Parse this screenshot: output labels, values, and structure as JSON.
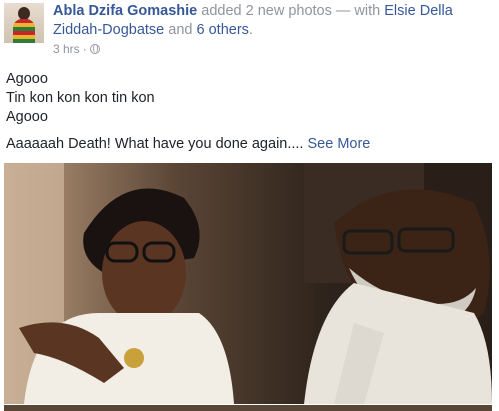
{
  "post": {
    "author": "Abla Dzifa Gomashie",
    "action": "added 2 new photos",
    "with_separator": "— with",
    "tagged": "Elsie Della Ziddah-Dogbatse",
    "and": "and",
    "others": "6 others",
    "period": ".",
    "timestamp": "3 hrs",
    "dot": "·",
    "privacy_icon": "globe-icon",
    "lines": [
      "Agooo",
      "Tin kon kon kon tin kon",
      "Agooo"
    ],
    "last_line": "Aaaaaah Death! What have you done again....",
    "see_more": "See More"
  }
}
